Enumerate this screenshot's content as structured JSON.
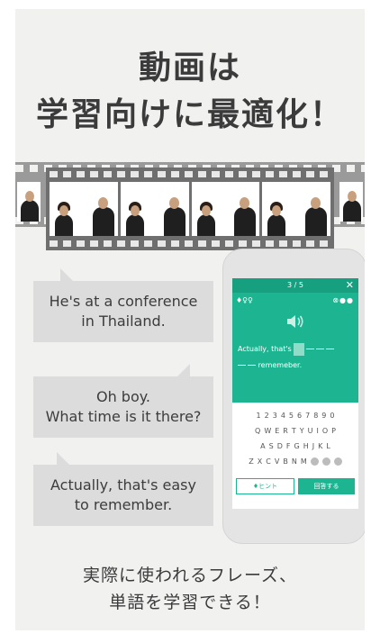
{
  "headline": {
    "line1": "動画は",
    "line2": "学習向けに最適化！"
  },
  "bubbles": [
    {
      "line1": "He's at a conference",
      "line2": "in Thailand."
    },
    {
      "line1": "Oh boy.",
      "line2": "What time is it there?"
    },
    {
      "line1": "Actually, that's easy",
      "line2": "to remember."
    }
  ],
  "phone": {
    "progress": "3 / 5",
    "close": "✕",
    "hint_icons": "♦♀♀",
    "status_dots": "⊗●●",
    "sentence_start": "Actually, that's",
    "sentence_end": "rememeber.",
    "keyboard": {
      "row1": [
        "1",
        "2",
        "3",
        "4",
        "5",
        "6",
        "7",
        "8",
        "9",
        "0"
      ],
      "row2": [
        "Q",
        "W",
        "E",
        "R",
        "T",
        "Y",
        "U",
        "I",
        "O",
        "P"
      ],
      "row3": [
        "A",
        "S",
        "D",
        "F",
        "G",
        "H",
        "J",
        "K",
        "L"
      ],
      "row4": [
        "Z",
        "X",
        "C",
        "V",
        "B",
        "N",
        "M"
      ]
    },
    "hint_button": "♦ヒント",
    "answer_button": "回答する"
  },
  "footer": {
    "line1": "実際に使われるフレーズ、",
    "line2": "単語を学習できる！"
  },
  "colors": {
    "accent": "#1db591",
    "panel": "#f1f1f0",
    "bubble": "#dcdcdc"
  }
}
